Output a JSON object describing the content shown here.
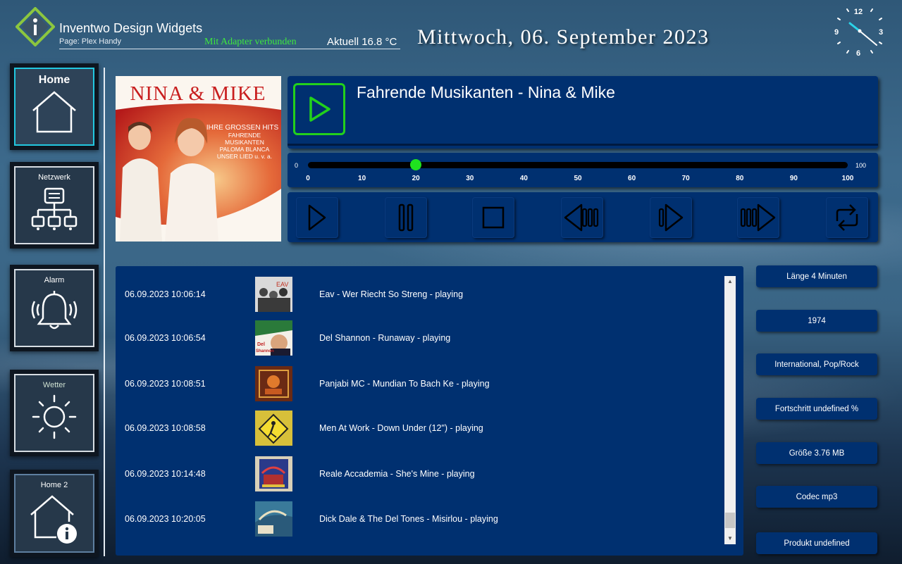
{
  "header": {
    "app_title": "Inventwo Design Widgets",
    "page_label": "Page: Plex Handy",
    "connection_status": "Mit Adapter verbunden",
    "temperature": "Aktuell 16.8 °C",
    "date": "Mittwoch, 06. September 2023",
    "clock": {
      "numerals": [
        "12",
        "3",
        "6",
        "9"
      ],
      "hour": 10,
      "minute": 15
    }
  },
  "nav": [
    {
      "label": "Home",
      "icon": "house-icon",
      "active": true
    },
    {
      "label": "Netzwerk",
      "icon": "network-icon"
    },
    {
      "label": "Alarm",
      "icon": "bell-icon"
    },
    {
      "label": "Wetter",
      "icon": "sun-icon"
    },
    {
      "label": "Home 2",
      "icon": "house-info-icon"
    }
  ],
  "album": {
    "artist_text": "NINA & MIKE",
    "tagline": [
      "IHRE GROSSEN HITS",
      "FAHRENDE",
      "MUSIKANTEN",
      "PALOMA BLANCA",
      "UNSER LIED u. v. a."
    ]
  },
  "player": {
    "track_title": "Fahrende Musikanten - Nina & Mike",
    "progress": {
      "value": 20,
      "min_label": "0",
      "max_label": "100",
      "ticks": [
        "0",
        "10",
        "20",
        "30",
        "40",
        "50",
        "60",
        "70",
        "80",
        "90",
        "100"
      ]
    },
    "controls": [
      "play-icon",
      "pause-icon",
      "stop-icon",
      "previous-icon",
      "forward-icon",
      "next-icon",
      "repeat-icon"
    ]
  },
  "history": [
    {
      "time": "06.09.2023 10:06:14",
      "text": "Eav - Wer Riecht So Streng - playing"
    },
    {
      "time": "06.09.2023 10:06:54",
      "text": "Del Shannon - Runaway - playing"
    },
    {
      "time": "06.09.2023 10:08:51",
      "text": "Panjabi MC - Mundian To Bach Ke - playing"
    },
    {
      "time": "06.09.2023 10:08:58",
      "text": "Men At Work - Down Under (12\") - playing"
    },
    {
      "time": "06.09.2023 10:14:48",
      "text": "Reale Accademia - She's Mine - playing"
    },
    {
      "time": "06.09.2023 10:20:05",
      "text": "Dick Dale & The Del Tones - Misirlou - playing"
    }
  ],
  "info": [
    "Länge 4 Minuten",
    "1974",
    "International, Pop/Rock",
    "Fortschritt undefined %",
    "Größe 3.76 MB",
    "Codec mp3",
    "Produkt undefined"
  ],
  "colors": {
    "panel": "#003070",
    "accent_green": "#22d11c",
    "active_nav": "#22c8e0"
  }
}
